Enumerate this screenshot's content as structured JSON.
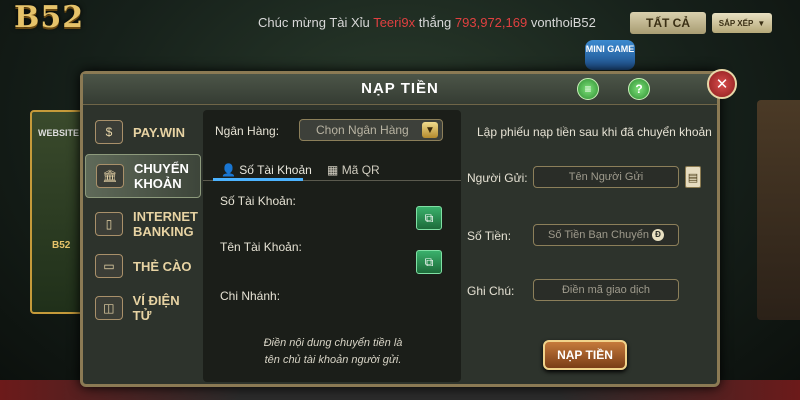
{
  "background": {
    "logo": "B52",
    "ticker": {
      "prefix": "Chúc mừng Tài Xỉu",
      "user": "Teeri9x",
      "verb": "thắng",
      "amount": "793,972,169",
      "user2": "vonthoiB52"
    },
    "tab_all": "TẤT CẢ",
    "sort_label": "SẮP XẾP",
    "mini_game": "MINI GAME",
    "tile_website": "WEBSITE",
    "tile_b52": "B52"
  },
  "modal": {
    "title": "NẠP TIỀN",
    "header_icons": [
      "list-icon",
      "help-icon"
    ],
    "help_label": "?",
    "close_label": "✕"
  },
  "sidebar": {
    "items": [
      {
        "label": "PAY.WIN",
        "icon": "wallet-icon",
        "active": false
      },
      {
        "label": "CHUYỂN KHOẢN",
        "icon": "bank-icon",
        "active": true
      },
      {
        "label": "INTERNET BANKING",
        "icon": "phone-icon",
        "active": false
      },
      {
        "label": "THẺ CÀO",
        "icon": "card-icon",
        "active": false
      },
      {
        "label": "VÍ ĐIỆN TỬ",
        "icon": "e-wallet-icon",
        "active": false
      }
    ]
  },
  "bank_panel": {
    "bank_label": "Ngân Hàng:",
    "bank_select_placeholder": "Chọn Ngân Hàng",
    "tabs": [
      {
        "label": "Số Tài Khoản",
        "icon": "user-icon",
        "active": true
      },
      {
        "label": "Mã QR",
        "icon": "qr-icon",
        "active": false
      }
    ],
    "account_number_label": "Số Tài Khoản:",
    "account_name_label": "Tên Tài Khoản:",
    "branch_label": "Chi Nhánh:",
    "note_line1": "Điền nội dung chuyển tiền là",
    "note_line2": "tên chủ tài khoản người gửi."
  },
  "form": {
    "heading": "Lập phiếu nạp tiền sau khi đã chuyển khoản",
    "sender_label": "Người Gửi:",
    "sender_placeholder": "Tên Người Gửi",
    "amount_label": "Số Tiền:",
    "amount_placeholder": "Số Tiền Bạn Chuyển",
    "amount_suffix": "Đ",
    "note_label": "Ghi Chú:",
    "note_placeholder": "Điền mã giao dịch",
    "submit_label": "NẠP TIỀN"
  }
}
